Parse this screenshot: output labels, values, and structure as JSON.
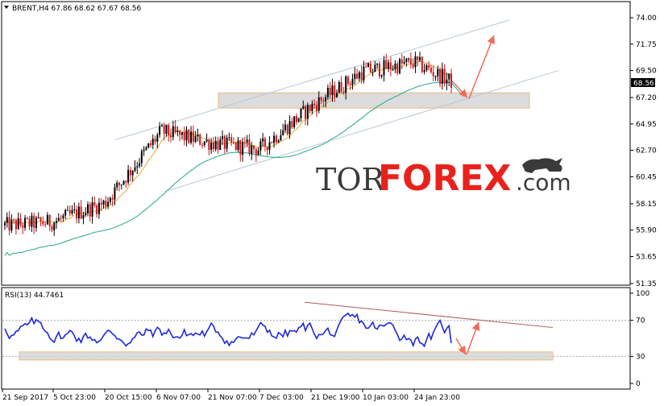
{
  "header": {
    "symbol_line": "BRENT,H4 67.86 68.62 67.67 68.56",
    "rsi_line": "RSI(13) 44.7461"
  },
  "watermark": {
    "tor": "TOR",
    "forex": "FOREX",
    "com": ".com"
  },
  "current_price": "68.56",
  "colors": {
    "up_candle": "#000000",
    "down_candle": "#d4141a",
    "ma_fast": "#e7a92d",
    "ma_slow": "#20a88c",
    "channel": "#b8c7d6",
    "support_zone_fill": "#d6d6d6",
    "support_zone_border": "#e5b06a",
    "arrow": "#f06a5a",
    "rsi_line": "#1d28d8",
    "rsi_trend": "#b05a55",
    "price_tag_bg": "#000000"
  },
  "chart_data": [
    {
      "type": "candlestick",
      "title": "BRENT,H4",
      "ohlc_last": {
        "open": 67.86,
        "high": 68.62,
        "low": 67.67,
        "close": 68.56
      },
      "x_tick_labels": [
        "21 Sep 2017",
        "5 Oct 23:00",
        "20 Oct 15:00",
        "6 Nov 07:00",
        "21 Nov 07:00",
        "7 Dec 03:00",
        "21 Dec 19:00",
        "10 Jan 03:00",
        "24 Jan 23:00"
      ],
      "y_tick_labels": [
        "74.00",
        "71.75",
        "69.50",
        "67.20",
        "64.95",
        "62.70",
        "60.45",
        "58.15",
        "55.90",
        "53.65",
        "51.35"
      ],
      "ylim": [
        51.35,
        74.0
      ],
      "approx_close_path": [
        {
          "x": "21 Sep 2017",
          "y": 56.3
        },
        {
          "x": "5 Oct 23:00",
          "y": 56.6
        },
        {
          "x": "20 Oct 15:00",
          "y": 58.2
        },
        {
          "x": "6 Nov 07:00",
          "y": 64.3
        },
        {
          "x": "21 Nov 07:00",
          "y": 63.4
        },
        {
          "x": "7 Dec 03:00",
          "y": 62.8
        },
        {
          "x": "21 Dec 19:00",
          "y": 66.4
        },
        {
          "x": "10 Jan 03:00",
          "y": 69.4
        },
        {
          "x": "24 Jan 23:00",
          "y": 70.2
        },
        {
          "x": "end",
          "y": 68.56
        }
      ],
      "indicators": [
        "moving average (fast)",
        "moving average (slow)"
      ],
      "annotations": [
        "ascending channel",
        "support zone 66.4-67.6",
        "arrows: pullback to support then rise toward ~72"
      ]
    },
    {
      "type": "line",
      "title": "RSI(13) 44.7461",
      "y_tick_labels": [
        "100",
        "70",
        "30",
        "0"
      ],
      "ylim": [
        0,
        100
      ],
      "levels": [
        70,
        30
      ],
      "last_value": 44.7461,
      "annotations": [
        "descending trendline",
        "support zone near 30",
        "arrows: dip then rise"
      ]
    }
  ]
}
